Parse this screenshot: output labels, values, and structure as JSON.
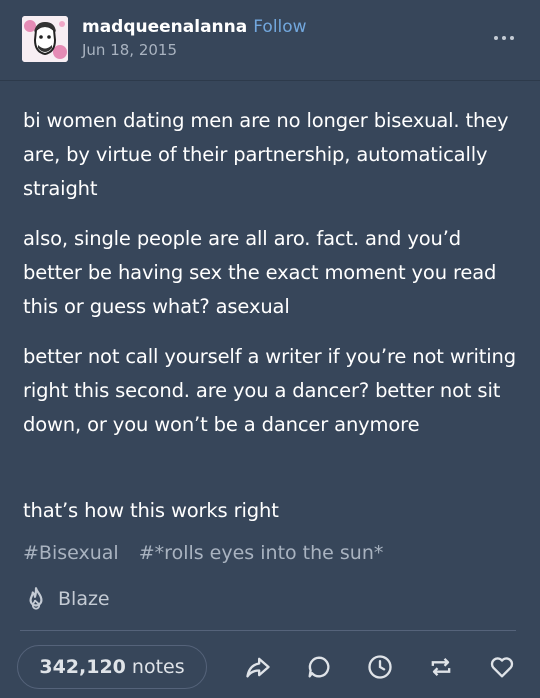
{
  "post": {
    "username": "madqueenalanna",
    "follow_label": "Follow",
    "date": "Jun 18, 2015",
    "paragraphs": [
      "bi women dating men are no longer bisexual. they are, by virtue of their partnership, automatically straight",
      "also, single people are all aro. fact. and you’d better be having sex the exact moment you read this or guess what? asexual",
      "better not call yourself a writer if you’re not writing right this second. are you a dancer? better not sit down, or you won’t be a dancer anymore",
      "that’s how this works right"
    ],
    "tags": [
      "#Bisexual",
      "#*rolls eyes into the sun*"
    ],
    "blaze_label": "Blaze"
  },
  "footer": {
    "notes_count": "342,120",
    "notes_label": "notes",
    "actions": [
      "share-icon",
      "reply-icon",
      "history-icon",
      "reblog-icon",
      "like-icon"
    ]
  },
  "colors": {
    "background": "#37465a",
    "follow": "#72a7dd",
    "muted": "#a9b3c0"
  }
}
